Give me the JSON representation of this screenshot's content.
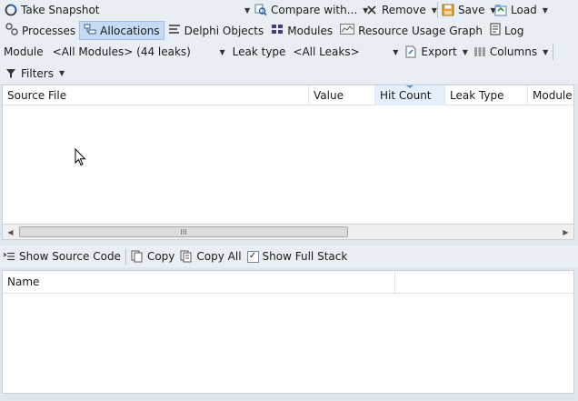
{
  "toolbar": {
    "take_snapshot": "Take Snapshot",
    "compare_with": "Compare with...",
    "remove": "Remove",
    "save": "Save",
    "load": "Load"
  },
  "tabs": [
    {
      "label": "Processes",
      "icon": "processes-icon"
    },
    {
      "label": "Allocations",
      "icon": "allocations-icon",
      "active": true
    },
    {
      "label": "Delphi Objects",
      "icon": "delphi-objects-icon"
    },
    {
      "label": "Modules",
      "icon": "modules-icon"
    },
    {
      "label": "Resource Usage Graph",
      "icon": "graph-icon"
    },
    {
      "label": "Log",
      "icon": "log-icon"
    }
  ],
  "filters": {
    "module_label": "Module",
    "module_value": "<All Modules> (44 leaks)",
    "leak_type_label": "Leak type",
    "leak_type_value": "<All Leaks>",
    "export": "Export",
    "columns": "Columns",
    "filters_label": "Filters"
  },
  "allocations_grid": {
    "columns": [
      "Source File",
      "Value",
      "Hit Count",
      "Leak Type",
      "Module"
    ],
    "sorted_column": "Hit Count",
    "rows": []
  },
  "stack_toolbar": {
    "show_source_code": "Show Source Code",
    "copy": "Copy",
    "copy_all": "Copy All",
    "show_full_stack": "Show Full Stack",
    "show_full_stack_checked": true
  },
  "stack_grid": {
    "columns": [
      "Name"
    ],
    "rows": []
  },
  "scrollbar": {
    "grip": "III"
  },
  "colors": {
    "background": "#dfe6ee",
    "active_tab": "#c5dbf3",
    "sorted_header": "#e3effb"
  }
}
